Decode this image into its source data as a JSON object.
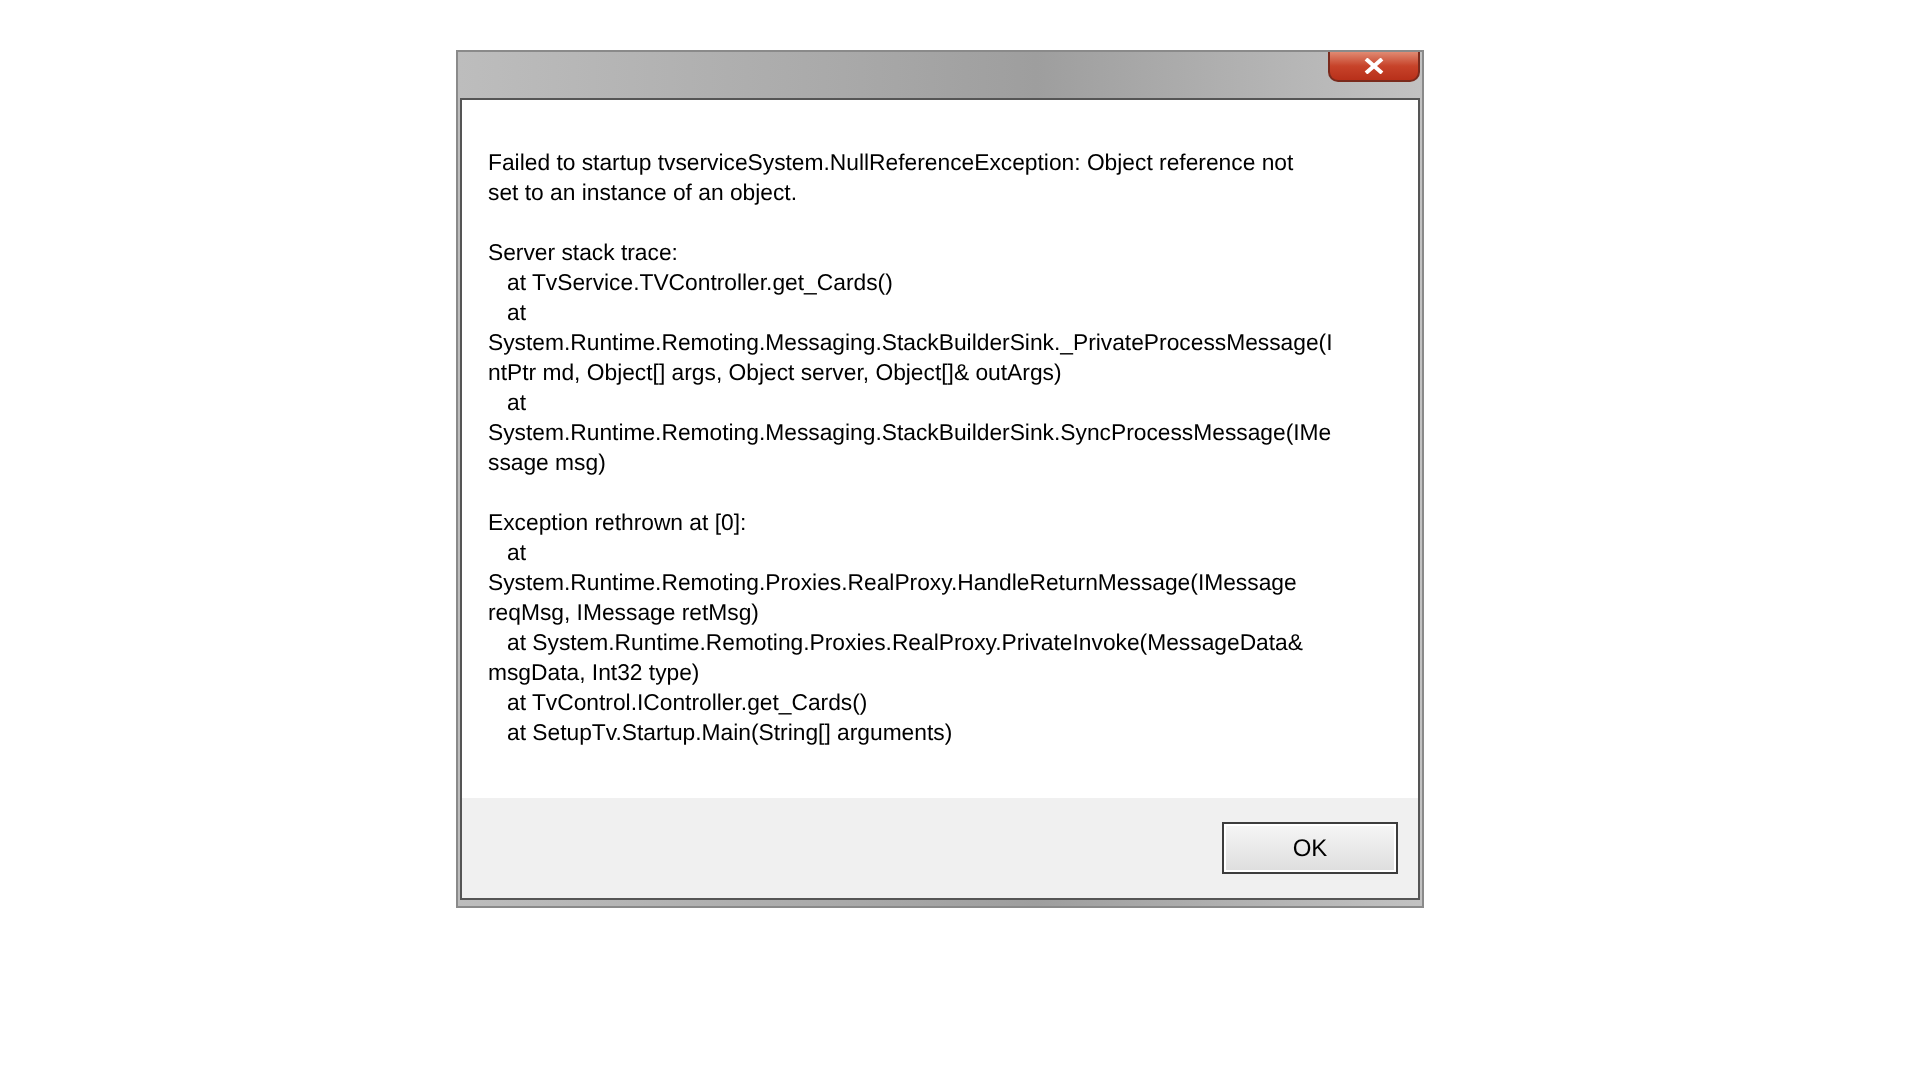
{
  "dialog": {
    "message": [
      [
        "Failed to startup tvserviceSystem.NullReferenceException: Object reference not",
        "set to an instance of an object."
      ],
      [
        "Server stack trace:",
        "   at TvService.TVController.get_Cards()",
        "   at",
        "System.Runtime.Remoting.Messaging.StackBuilderSink._PrivateProcessMessage(I",
        "ntPtr md, Object[] args, Object server, Object[]& outArgs)",
        "   at",
        "System.Runtime.Remoting.Messaging.StackBuilderSink.SyncProcessMessage(IMe",
        "ssage msg)"
      ],
      [
        "Exception rethrown at [0]:",
        "   at",
        "System.Runtime.Remoting.Proxies.RealProxy.HandleReturnMessage(IMessage",
        "reqMsg, IMessage retMsg)",
        "   at System.Runtime.Remoting.Proxies.RealProxy.PrivateInvoke(MessageData&",
        "msgData, Int32 type)",
        "   at TvControl.IController.get_Cards()",
        "   at SetupTv.Startup.Main(String[] arguments)"
      ]
    ],
    "buttons": [
      {
        "label": "OK"
      }
    ]
  }
}
